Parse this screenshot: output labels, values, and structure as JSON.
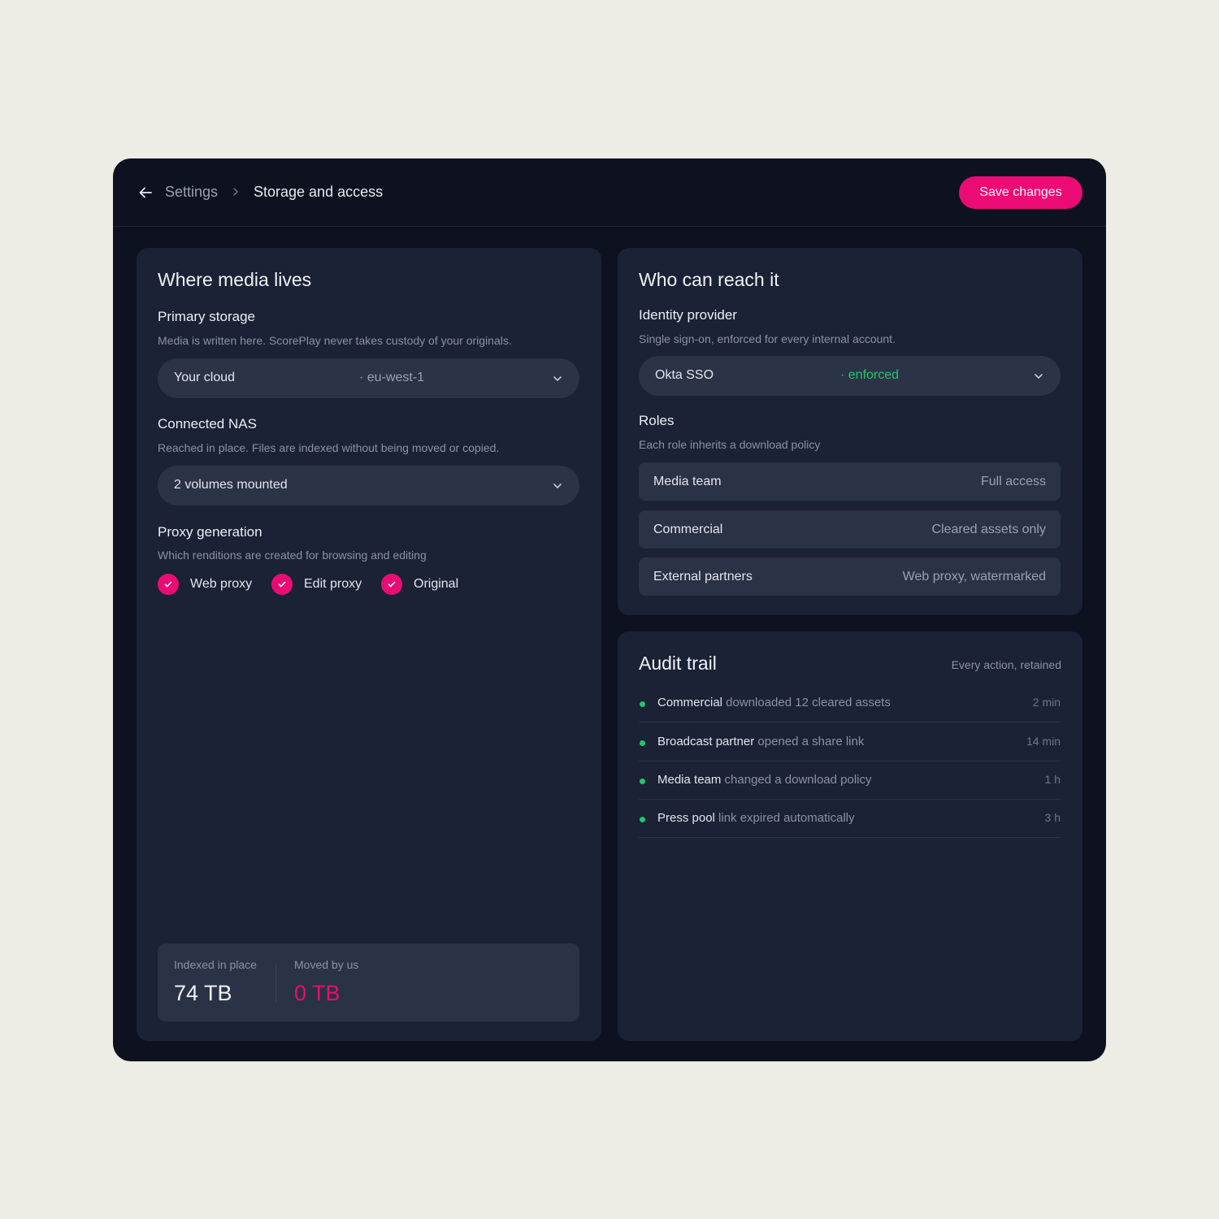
{
  "header": {
    "back_icon": "arrow-left-icon",
    "breadcrumb_root": "Settings",
    "breadcrumb_current": "Storage and access",
    "save_label": "Save changes",
    "accent": "#ec0b74"
  },
  "media": {
    "title": "Where media lives",
    "primary": {
      "heading": "Primary storage",
      "description": "Media is written here. ScorePlay never takes custody of your originals.",
      "value": "Your cloud",
      "meta": "· eu-west-1"
    },
    "nas": {
      "heading": "Connected NAS",
      "description": "Reached in place. Files are indexed without being moved or copied.",
      "value": "2 volumes mounted"
    },
    "proxy": {
      "heading": "Proxy generation",
      "description": "Which renditions are created for browsing and editing",
      "options": [
        {
          "label": "Web proxy",
          "checked": true
        },
        {
          "label": "Edit proxy",
          "checked": true
        },
        {
          "label": "Original",
          "checked": true
        }
      ]
    },
    "stats": {
      "indexed_label": "Indexed in place",
      "indexed_value": "74 TB",
      "moved_label": "Moved by us",
      "moved_value": "0 TB"
    }
  },
  "access": {
    "title": "Who can reach it",
    "idp": {
      "heading": "Identity provider",
      "description": "Single sign-on, enforced for every internal account.",
      "value": "Okta SSO",
      "status": "· enforced",
      "status_color": "#22c66c"
    },
    "roles": {
      "heading": "Roles",
      "description": "Each role inherits a download policy",
      "items": [
        {
          "name": "Media team",
          "policy": "Full access"
        },
        {
          "name": "Commercial",
          "policy": "Cleared assets only"
        },
        {
          "name": "External partners",
          "policy": "Web proxy, watermarked"
        }
      ]
    }
  },
  "audit": {
    "title": "Audit trail",
    "subtitle": "Every action, retained",
    "entries": [
      {
        "actor": "Commercial",
        "action": " downloaded 12 cleared assets",
        "time": "2 min"
      },
      {
        "actor": "Broadcast partner",
        "action": " opened a share link",
        "time": "14 min"
      },
      {
        "actor": "Media team",
        "action": " changed a download policy",
        "time": "1 h"
      },
      {
        "actor": "Press pool",
        "action": " link expired automatically",
        "time": "3 h"
      }
    ]
  }
}
